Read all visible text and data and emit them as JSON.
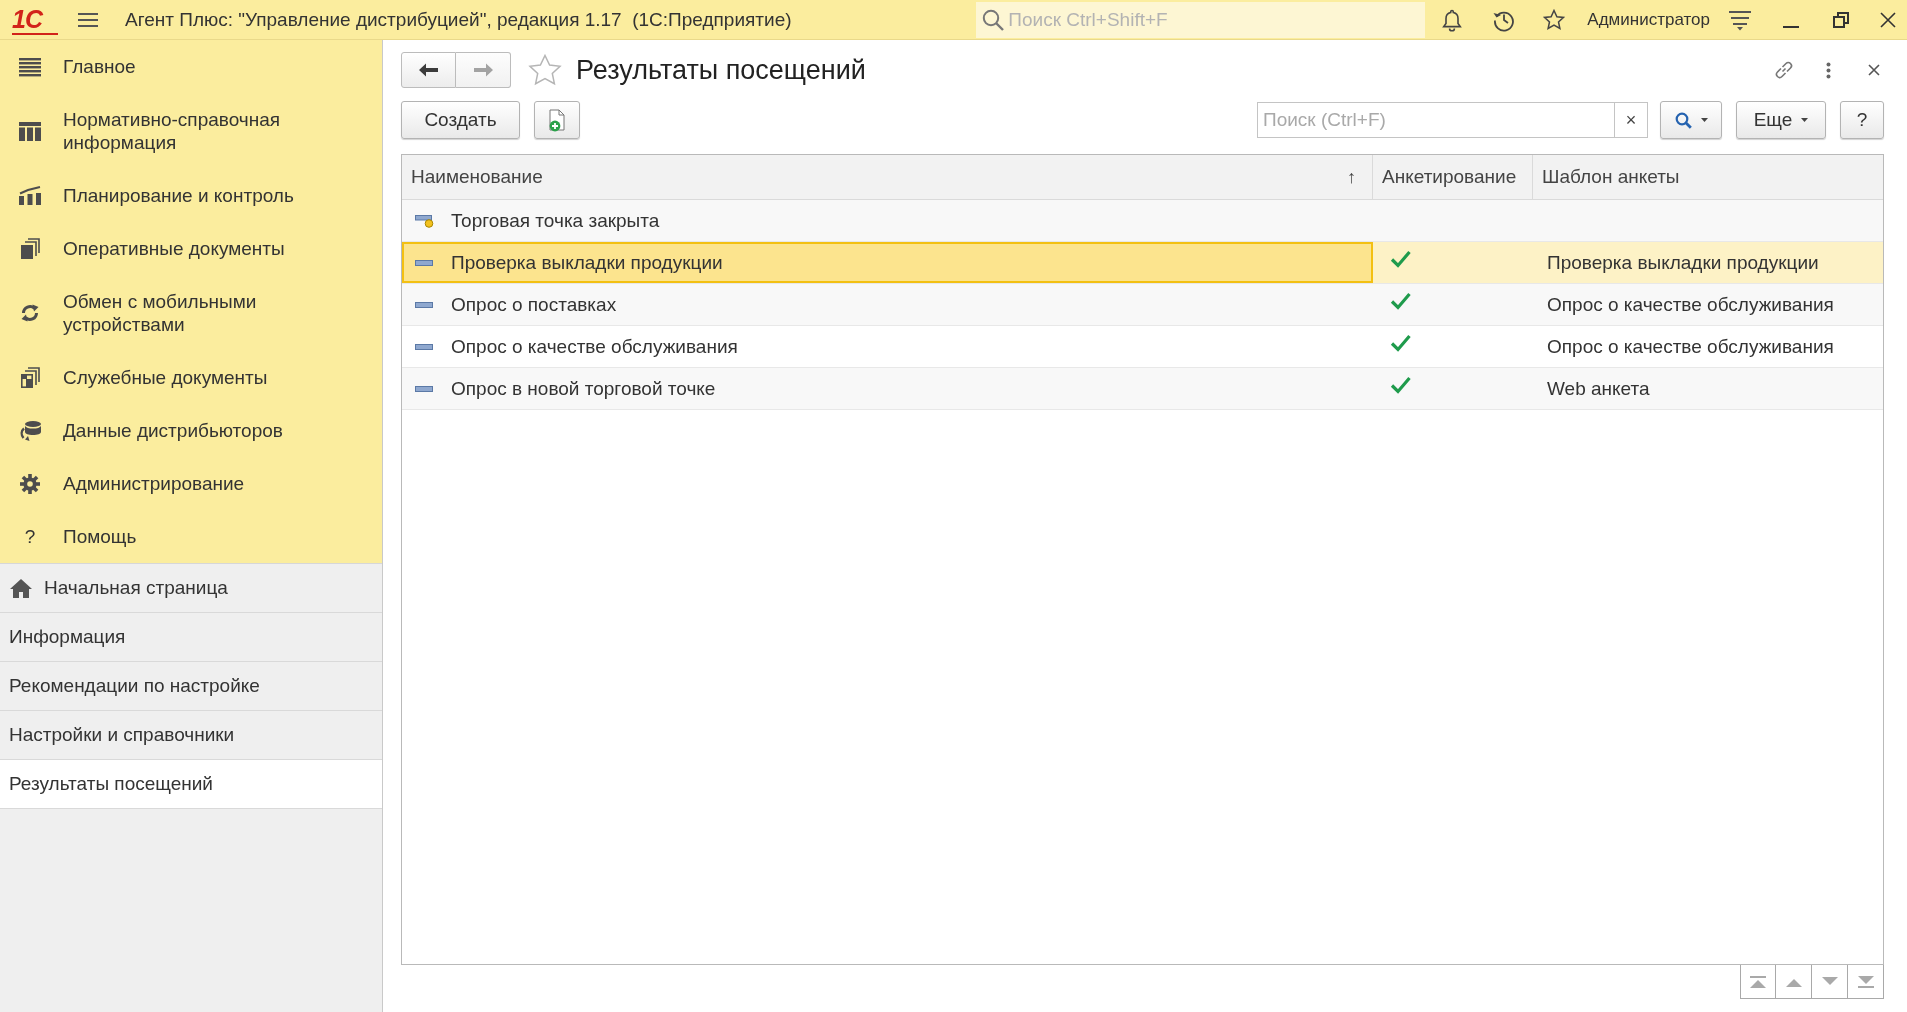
{
  "app_bar": {
    "logo": "1С",
    "title": "Агент Плюс: \"Управление дистрибуцией\", редакция 1.17  (1С:Предприятие)",
    "search": {
      "placeholder": "Поиск Ctrl+Shift+F"
    },
    "user": "Администратор"
  },
  "sidebar": {
    "sections": [
      {
        "label": "Главное",
        "kind": "main"
      },
      {
        "label": "Нормативно-справочная информация",
        "kind": "catalog"
      },
      {
        "label": "Планирование и контроль",
        "kind": "planning"
      },
      {
        "label": "Оперативные документы",
        "kind": "documents"
      },
      {
        "label": "Обмен с мобильными устройствами",
        "kind": "exchange"
      },
      {
        "label": "Служебные документы",
        "kind": "service"
      },
      {
        "label": "Данные дистрибьюторов",
        "kind": "data"
      },
      {
        "label": "Администрирование",
        "kind": "admin"
      },
      {
        "label": "Помощь",
        "kind": "help",
        "icon_text": "?"
      }
    ],
    "open_windows": [
      {
        "label": "Начальная страница",
        "kind": "home",
        "selected": false
      },
      {
        "label": "Информация",
        "kind": "page",
        "selected": false
      },
      {
        "label": "Рекомендации по настройке",
        "kind": "page",
        "selected": false
      },
      {
        "label": "Настройки и справочники",
        "kind": "page",
        "selected": false
      },
      {
        "label": "Результаты посещений",
        "kind": "page",
        "selected": true
      }
    ]
  },
  "form": {
    "title": "Результаты посещений",
    "favorite": false,
    "nav": [
      {
        "kind": "back",
        "disabled": false
      },
      {
        "kind": "forward",
        "disabled": true
      }
    ],
    "toolbar": {
      "create": "Создать",
      "search": {
        "placeholder": "Поиск (Ctrl+F)",
        "clear": "×"
      },
      "more": "Еще",
      "help": "?"
    },
    "table": {
      "columns": [
        {
          "label": "Наименование",
          "sort": "↑"
        },
        {
          "label": "Анкетирование"
        },
        {
          "label": "Шаблон анкеты"
        }
      ],
      "rows": [
        {
          "name": "Торговая точка закрыта",
          "kind": "predefined",
          "surveying": false,
          "selected": false
        },
        {
          "name": "Проверка выкладки продукции",
          "kind": "regular",
          "surveying": true,
          "template": "Проверка выкладки продукции",
          "selected": true
        },
        {
          "name": "Опрос о поставках",
          "kind": "regular",
          "surveying": true,
          "template": "Опрос о качестве обслуживания",
          "selected": false
        },
        {
          "name": "Опрос о качестве обслуживания",
          "kind": "regular",
          "surveying": true,
          "template": "Опрос о качестве обслуживания",
          "selected": false
        },
        {
          "name": "Опрос в новой торговой точке",
          "kind": "regular",
          "surveying": true,
          "template": "Web анкета",
          "selected": false
        }
      ]
    }
  }
}
